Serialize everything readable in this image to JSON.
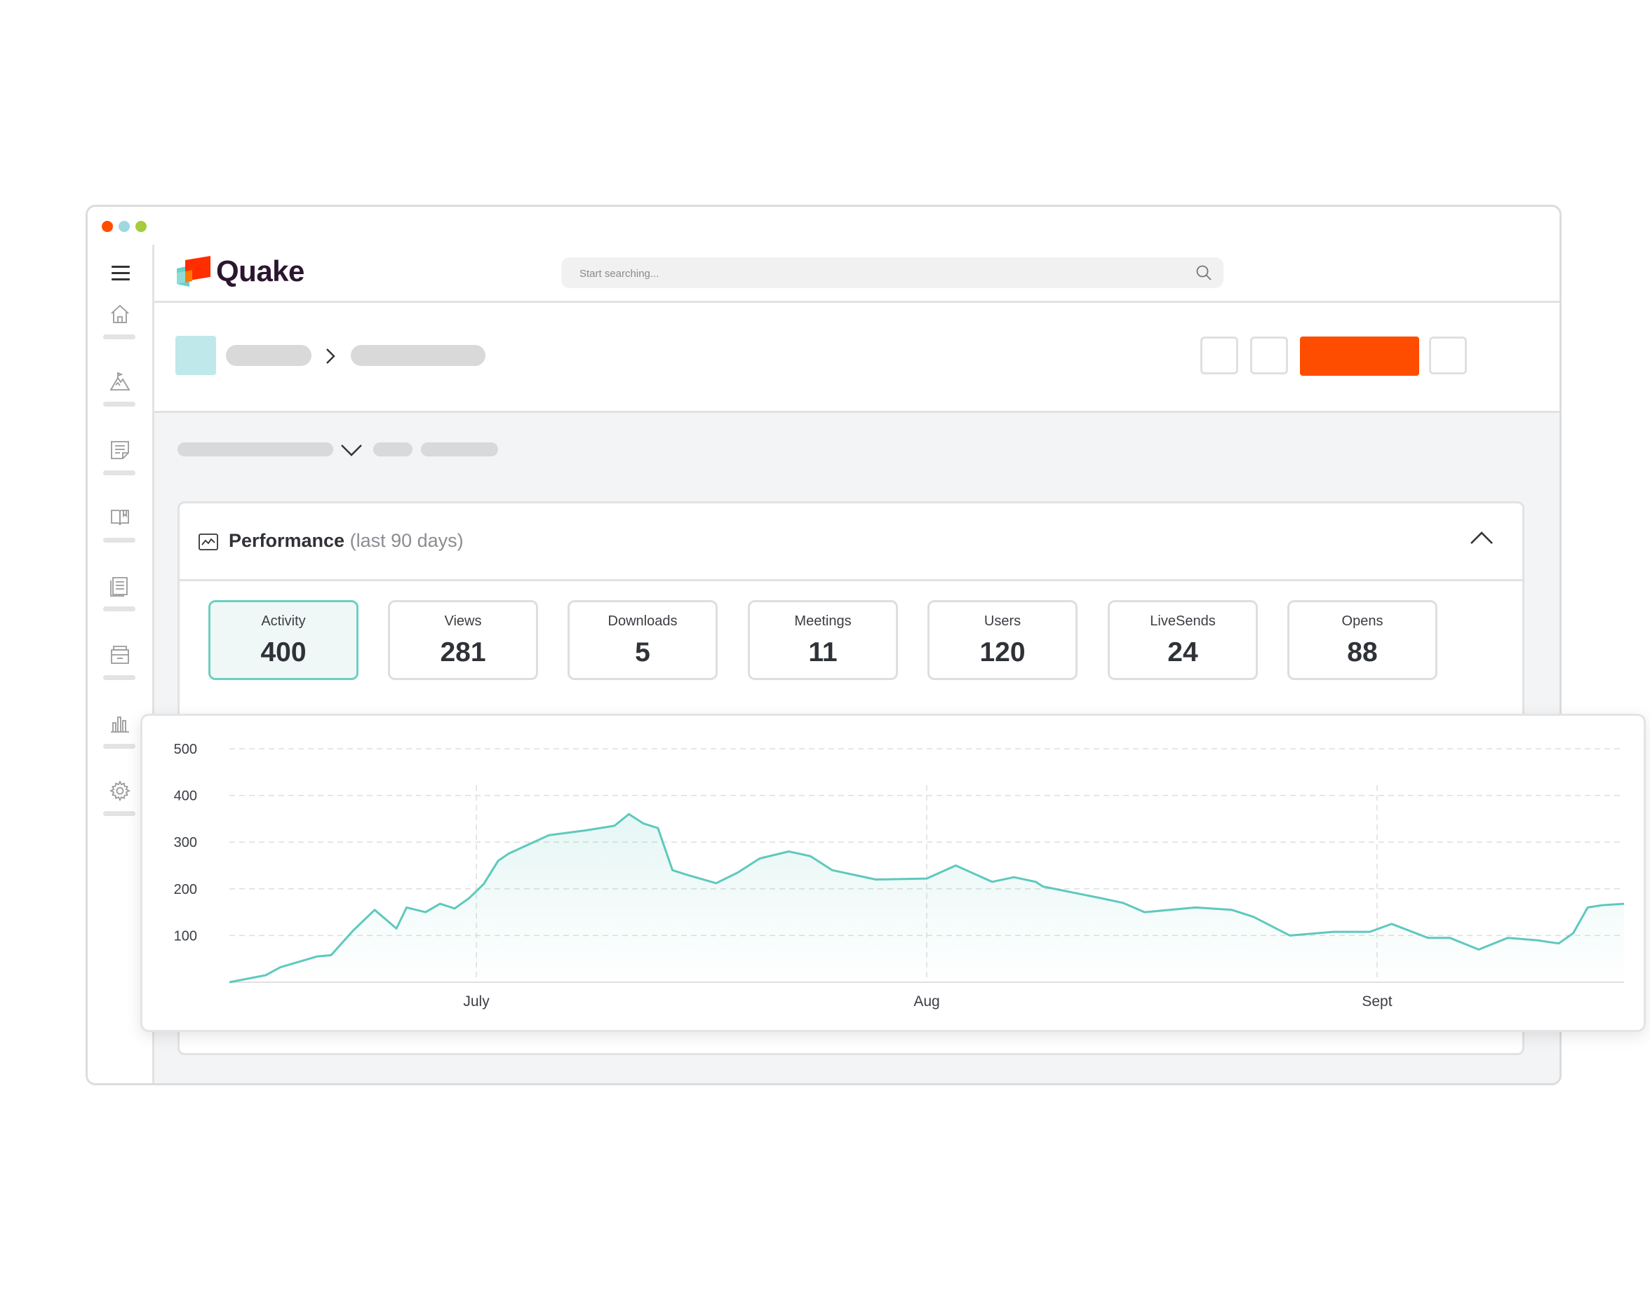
{
  "window": {
    "traffic_lights": [
      "#ff4d00",
      "#9fd8e0",
      "#a6cc3a"
    ]
  },
  "sidebar": {
    "items": [
      {
        "icon": "home-icon"
      },
      {
        "icon": "mountain-flag-icon"
      },
      {
        "icon": "note-edit-icon"
      },
      {
        "icon": "book-icon"
      },
      {
        "icon": "document-icon"
      },
      {
        "icon": "archive-icon"
      },
      {
        "icon": "bar-chart-icon"
      },
      {
        "icon": "gear-icon"
      }
    ]
  },
  "header": {
    "logo_text": "Quake",
    "search": {
      "placeholder": "Start searching..."
    }
  },
  "panel": {
    "title": "Performance",
    "subtitle": "(last 90 days)",
    "stats": [
      {
        "label": "Activity",
        "value": "400",
        "active": true
      },
      {
        "label": "Views",
        "value": "281"
      },
      {
        "label": "Downloads",
        "value": "5"
      },
      {
        "label": "Meetings",
        "value": "11"
      },
      {
        "label": "Users",
        "value": "120"
      },
      {
        "label": "LiveSends",
        "value": "24"
      },
      {
        "label": "Opens",
        "value": "88"
      }
    ]
  },
  "colors": {
    "accent": "#ff4d00",
    "line": "#5ec9bd",
    "active_card_bg": "#eff8f7",
    "active_card_border": "#6ccfc2"
  },
  "chart_data": {
    "type": "area",
    "title": "",
    "xlabel": "",
    "ylabel": "",
    "ylim": [
      0,
      500
    ],
    "yticks": [
      100,
      200,
      300,
      400,
      500
    ],
    "xticks": [
      {
        "label": "July",
        "day": 21
      },
      {
        "label": "Aug",
        "day": 52
      },
      {
        "label": "Sept",
        "day": 83
      }
    ],
    "grid": {
      "horizontal": "dashed",
      "vertical": "dashed at x ticks"
    },
    "x_range": [
      4,
      100
    ],
    "series": [
      {
        "x": [
          4,
          6.5,
          7.5,
          10,
          11,
          12.5,
          14,
          15.5,
          16.2,
          17.5,
          18.5,
          19.5,
          20.5,
          21.5,
          22.5,
          23.2,
          26,
          28.5,
          30.5,
          31.5,
          32.5,
          33.5,
          34.5,
          35.5,
          37.5,
          39,
          40.5,
          42.5,
          44,
          45.5,
          48.5,
          52,
          54,
          56.5,
          58,
          59.5,
          60,
          64,
          65.5,
          67,
          70.5,
          73,
          74.5,
          77,
          80,
          81.5,
          82.5,
          84,
          86.5,
          88,
          90,
          92,
          94,
          95.5,
          96.5,
          97.5,
          98.5,
          100
        ],
        "y": [
          0,
          15,
          32,
          55,
          58,
          110,
          155,
          115,
          160,
          150,
          168,
          158,
          180,
          210,
          260,
          275,
          315,
          325,
          335,
          360,
          340,
          330,
          240,
          230,
          212,
          235,
          265,
          280,
          270,
          240,
          220,
          222,
          250,
          215,
          225,
          215,
          205,
          180,
          170,
          150,
          160,
          155,
          140,
          100,
          108,
          108,
          108,
          125,
          95,
          95,
          70,
          95,
          90,
          83,
          105,
          160,
          165,
          168
        ]
      }
    ]
  }
}
